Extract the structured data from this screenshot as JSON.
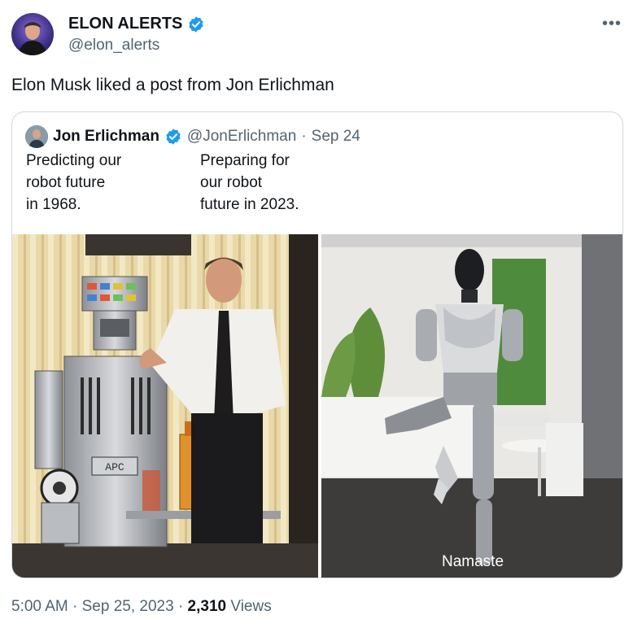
{
  "author": {
    "name": "ELON ALERTS",
    "handle": "@elon_alerts",
    "verified": true,
    "avatar_icon": "avatar-photo"
  },
  "menu_icon": "more-dots-icon",
  "text": "Elon Musk liked a post from Jon Erlichman",
  "quote": {
    "name": "Jon Erlichman",
    "handle": "@JonErlichman",
    "separator": "·",
    "date": "Sep 24",
    "verified": true,
    "caption_left": "Predicting our\nrobot future\nin 1968.",
    "caption_right": "Preparing for\nour robot\nfuture in 2023.",
    "image_left": {
      "robot_panel_label": "APC"
    },
    "image_right": {
      "subtitle": "Namaste"
    }
  },
  "meta": {
    "time": "5:00 AM",
    "sep1": "·",
    "date": "Sep 25, 2023",
    "sep2": "·",
    "views_count": "2,310",
    "views_label": "Views"
  },
  "colors": {
    "text": "#0f1419",
    "secondary": "#536471",
    "verified": "#1d9bf0",
    "border": "#cfd9de"
  }
}
